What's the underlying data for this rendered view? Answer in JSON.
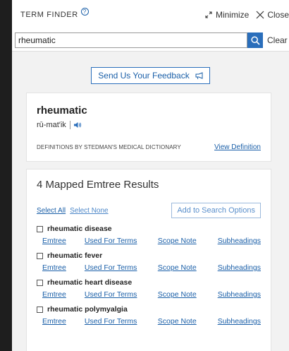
{
  "header": {
    "title": "TERM FINDER",
    "help_glyph": "?",
    "minimize_label": "Minimize",
    "close_label": "Close"
  },
  "search": {
    "value": "rheumatic",
    "clear_label": "Clear"
  },
  "feedback": {
    "label": "Send Us Your Feedback"
  },
  "definition": {
    "term": "rheumatic",
    "pronunciation": "rū-mat′ik",
    "source": "DEFINITIONS BY STEDMAN'S MEDICAL DICTIONARY",
    "view_label": "View Definition"
  },
  "results": {
    "title": "4 Mapped Emtree Results",
    "select_all": "Select All",
    "select_none": "Select None",
    "add_button": "Add to Search Options",
    "items": [
      {
        "prefix": "rheumatic",
        "suffix": " disease",
        "links": [
          "Emtree",
          "Used For Terms",
          "Scope Note",
          "Subheadings"
        ]
      },
      {
        "prefix": "rheumatic",
        "suffix": " fever",
        "links": [
          "Emtree",
          "Used For Terms",
          "Scope Note",
          "Subheadings"
        ]
      },
      {
        "prefix": "rheumatic",
        "suffix": " heart disease",
        "links": [
          "Emtree",
          "Used For Terms",
          "Scope Note",
          "Subheadings"
        ]
      },
      {
        "prefix": "rheumatic",
        "suffix": " polymyalgia",
        "links": [
          "Emtree",
          "Used For Terms",
          "Scope Note",
          "Subheadings"
        ]
      }
    ]
  },
  "icons": {
    "help": "help-icon",
    "minimize": "minimize-icon",
    "close": "close-icon",
    "search": "search-icon",
    "feedback": "feedback-icon",
    "audio": "speaker-icon"
  },
  "colors": {
    "accent": "#2a6ebb",
    "link": "#1a5fa8",
    "panel_bg": "#f2f2f2",
    "page_bg": "#1e1e1e"
  }
}
